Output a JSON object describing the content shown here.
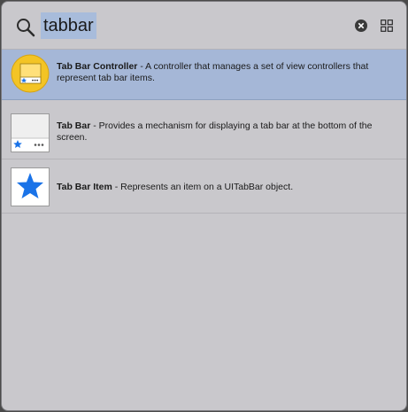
{
  "search": {
    "query": "tabbar",
    "icon": "search-icon",
    "clear_icon": "clear-icon",
    "view_icon": "grid-view-icon"
  },
  "results": [
    {
      "name": "Tab Bar Controller",
      "separator": " - ",
      "description": "A controller that manages a set of view controllers that represent tab bar items.",
      "icon": "tab-bar-controller-icon",
      "selected": true
    },
    {
      "name": "Tab Bar",
      "separator": " - ",
      "description": "Provides a mechanism for displaying a tab bar at the bottom of the screen.",
      "icon": "tab-bar-icon",
      "selected": false
    },
    {
      "name": "Tab Bar Item",
      "separator": " - ",
      "description": "Represents an item on a UITabBar object.",
      "icon": "star-icon",
      "selected": false
    }
  ],
  "colors": {
    "panel_background": "#c9c8cc",
    "selection": "#a5b7d7",
    "accent_blue": "#1a73e8",
    "controller_yellow": "#f3c425"
  }
}
